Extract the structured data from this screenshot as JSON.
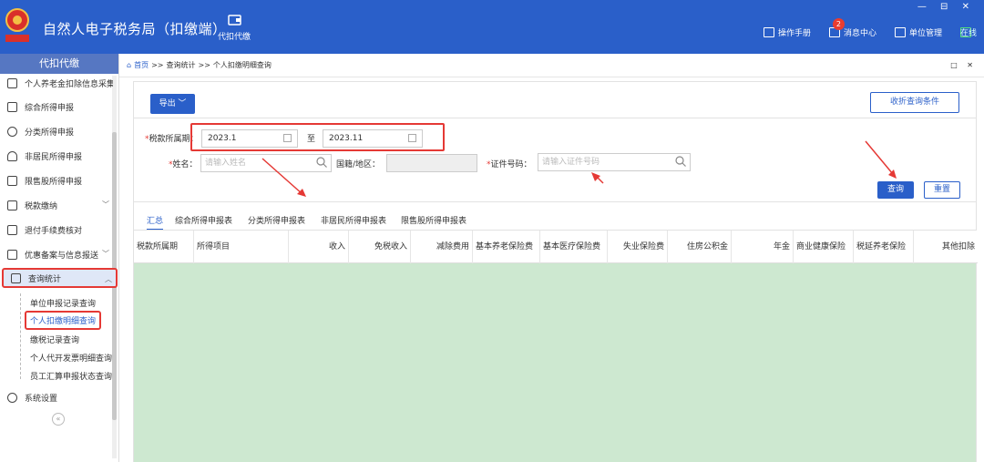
{
  "header": {
    "app_title": "自然人电子税务局（扣缴端）",
    "nav_tab": "代扣代缴",
    "window_controls": "— ⊟ ✕",
    "links": [
      {
        "label": "操作手册",
        "icon": "book-icon"
      },
      {
        "label": "消息中心",
        "icon": "mail-icon",
        "badge": "2"
      },
      {
        "label": "单位管理",
        "icon": "building-icon"
      },
      {
        "label": "在线",
        "icon": "monitor-icon"
      }
    ],
    "emblem_text": "中国税务",
    "colors": {
      "brand": "#2a5fc9",
      "highlight": "#e53935",
      "online": "#55e07a"
    }
  },
  "sidebar": {
    "title": "代扣代缴",
    "items": [
      {
        "label": "个人养老金扣除信息采集",
        "icon": "pension-icon"
      },
      {
        "label": "综合所得申报",
        "icon": "layers-icon"
      },
      {
        "label": "分类所得申报",
        "icon": "pie-icon"
      },
      {
        "label": "非居民所得申报",
        "icon": "person-icon"
      },
      {
        "label": "限售股所得申报",
        "icon": "bar-chart-icon"
      },
      {
        "label": "税款缴纳",
        "icon": "wallet-icon",
        "chevron": "﹀"
      },
      {
        "label": "退付手续费核对",
        "icon": "receipt-icon"
      },
      {
        "label": "优惠备案与信息报送",
        "icon": "doc-icon",
        "chevron": "﹀"
      },
      {
        "label": "查询统计",
        "icon": "query-icon",
        "chevron": "︿"
      },
      {
        "label": "系统设置",
        "icon": "gear-icon"
      }
    ],
    "sub_items": [
      "单位申报记录查询",
      "个人扣缴明细查询",
      "缴税记录查询",
      "个人代开发票明细查询",
      "员工汇算申报状态查询"
    ],
    "collapse_glyph": "«"
  },
  "breadcrumb": {
    "home": "首页",
    "sep": ">>",
    "level2": "查询统计",
    "level3": "个人扣缴明细查询",
    "controls": "□ ✕"
  },
  "toolbar": {
    "export_label": "导出 ﹀",
    "collapse_label": "收折查询条件"
  },
  "filters": {
    "period_label": "税款所属期：",
    "period_start": "2023.1",
    "period_to": "至",
    "period_end": "2023.11",
    "name_label": "姓名：",
    "name_placeholder": "请输入姓名",
    "country_label": "国籍/地区：",
    "id_label": "证件号码：",
    "id_placeholder": "请输入证件号码",
    "required_mark": "*",
    "query_button": "查询",
    "reset_button": "重置"
  },
  "tabs": [
    "汇总",
    "综合所得申报表",
    "分类所得申报表",
    "非居民所得申报表",
    "限售股所得申报表"
  ],
  "table": {
    "columns": [
      "税款所属期",
      "所得项目",
      "收入",
      "免税收入",
      "减除费用",
      "基本养老保险费",
      "基本医疗保险费",
      "失业保险费",
      "住房公积金",
      "年金",
      "商业健康保险",
      "税延养老保险",
      "其他扣除"
    ],
    "rows": []
  }
}
